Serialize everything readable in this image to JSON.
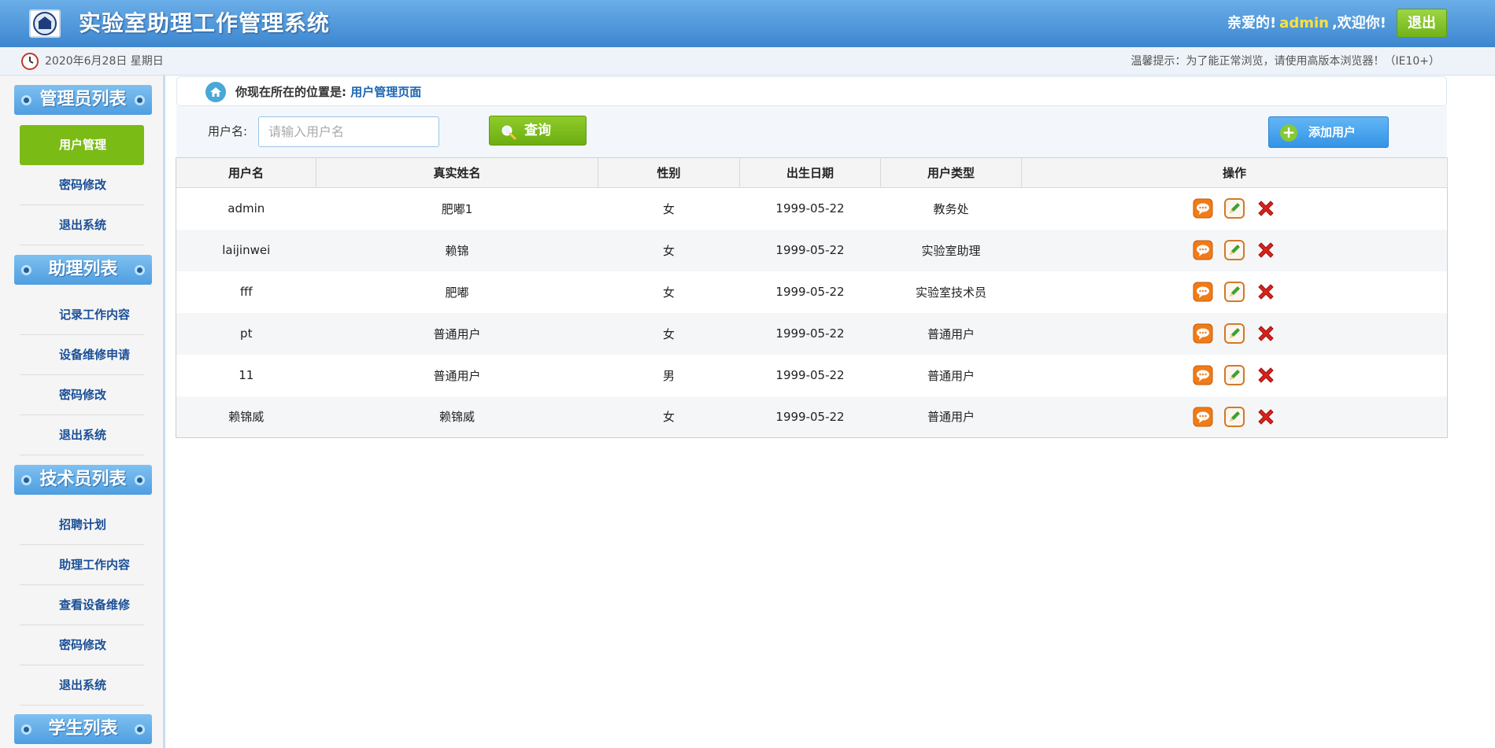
{
  "header": {
    "title": "实验室助理工作管理系统",
    "welcome_prefix": "亲爱的!",
    "username": "admin",
    "welcome_suffix": ",欢迎你!",
    "logout_label": "退出"
  },
  "infobar": {
    "date": "2020年6月28日 星期日",
    "tip": "温馨提示：为了能正常浏览，请使用高版本浏览器！（IE10+）"
  },
  "sidebar": {
    "groups": [
      {
        "title": "管理员列表",
        "items": [
          "用户管理",
          "密码修改",
          "退出系统"
        ]
      },
      {
        "title": "助理列表",
        "items": [
          "记录工作内容",
          "设备维修申请",
          "密码修改",
          "退出系统"
        ]
      },
      {
        "title": "技术员列表",
        "items": [
          "招聘计划",
          "助理工作内容",
          "查看设备维修",
          "密码修改",
          "退出系统"
        ]
      },
      {
        "title": "学生列表",
        "items": []
      }
    ],
    "active_item": "用户管理"
  },
  "breadcrumb": {
    "prefix": "你现在所在的位置是:",
    "current": "用户管理页面"
  },
  "search": {
    "label": "用户名:",
    "placeholder": "请输入用户名",
    "value": "",
    "query_label": "查询",
    "add_label": "添加用户"
  },
  "table": {
    "columns": [
      "用户名",
      "真实姓名",
      "性别",
      "出生日期",
      "用户类型",
      "操作"
    ],
    "rows": [
      [
        "admin",
        "肥嘟1",
        "女",
        "1999-05-22",
        "教务处"
      ],
      [
        "laijinwei",
        "赖锦",
        "女",
        "1999-05-22",
        "实验室助理"
      ],
      [
        "fff",
        "肥嘟",
        "女",
        "1999-05-22",
        "实验室技术员"
      ],
      [
        "pt",
        "普通用户",
        "女",
        "1999-05-22",
        "普通用户"
      ],
      [
        "11",
        "普通用户",
        "男",
        "1999-05-22",
        "普通用户"
      ],
      [
        "赖锦威",
        "赖锦威",
        "女",
        "1999-05-22",
        "普通用户"
      ]
    ],
    "row_actions": [
      "view-icon",
      "edit-icon",
      "delete-icon"
    ]
  },
  "colors": {
    "header": "#3d86cf",
    "active_menu": "#7bbb16",
    "link": "#1b65b3",
    "username": "#ffe13c"
  }
}
